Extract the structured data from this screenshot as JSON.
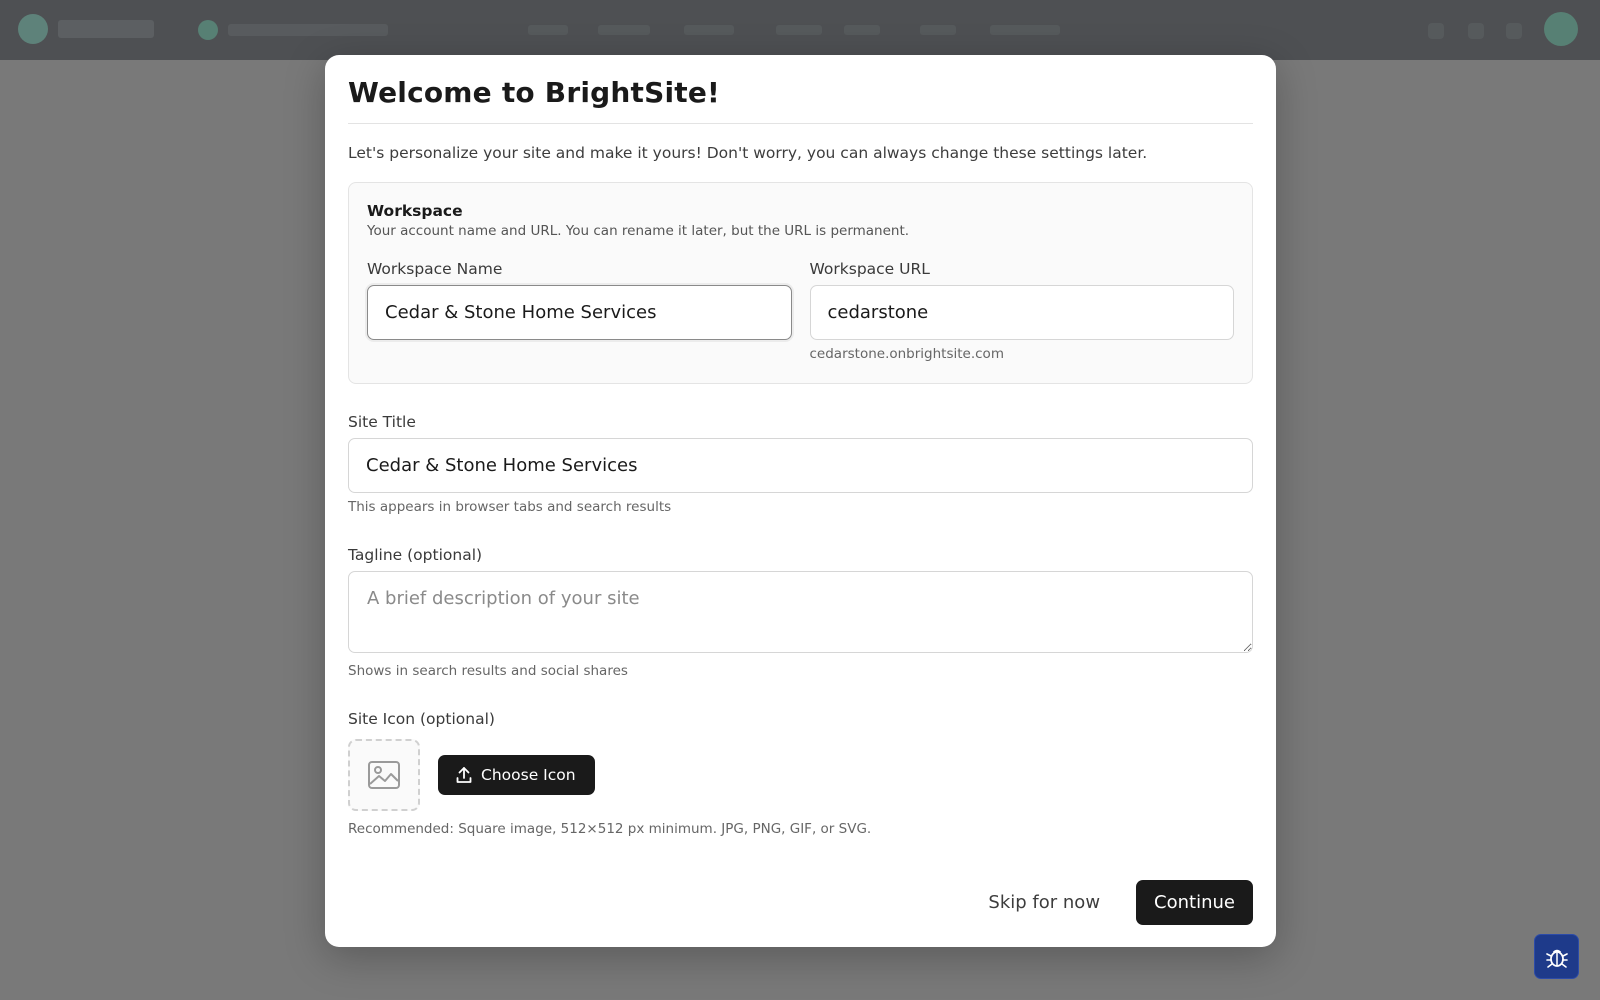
{
  "modal": {
    "title": "Welcome to BrightSite!",
    "intro": "Let's personalize your site and make it yours! Don't worry, you can always change these settings later."
  },
  "workspace": {
    "title": "Workspace",
    "description": "Your account name and URL. You can rename it later, but the URL is permanent.",
    "name_label": "Workspace Name",
    "name_value": "Cedar & Stone Home Services",
    "url_label": "Workspace URL",
    "url_value": "cedarstone",
    "url_preview": "cedarstone.onbrightsite.com"
  },
  "site_title": {
    "label": "Site Title",
    "value": "Cedar & Stone Home Services",
    "hint": "This appears in browser tabs and search results"
  },
  "tagline": {
    "label": "Tagline (optional)",
    "placeholder": "A brief description of your site",
    "value": "",
    "hint": "Shows in search results and social shares"
  },
  "site_icon": {
    "label": "Site Icon (optional)",
    "placeholder_icon": "image-icon",
    "button_icon": "upload-icon",
    "button_label": "Choose Icon",
    "hint": "Recommended: Square image, 512×512 px minimum. JPG, PNG, GIF, or SVG."
  },
  "footer": {
    "skip_label": "Skip for now",
    "continue_label": "Continue"
  },
  "debug_button": {
    "icon": "bug-icon"
  },
  "colors": {
    "primary_button": "#1a1a1a",
    "debug_button": "#1e3a8a",
    "topbar": "#1c2126",
    "accent": "#2f8a6f"
  }
}
